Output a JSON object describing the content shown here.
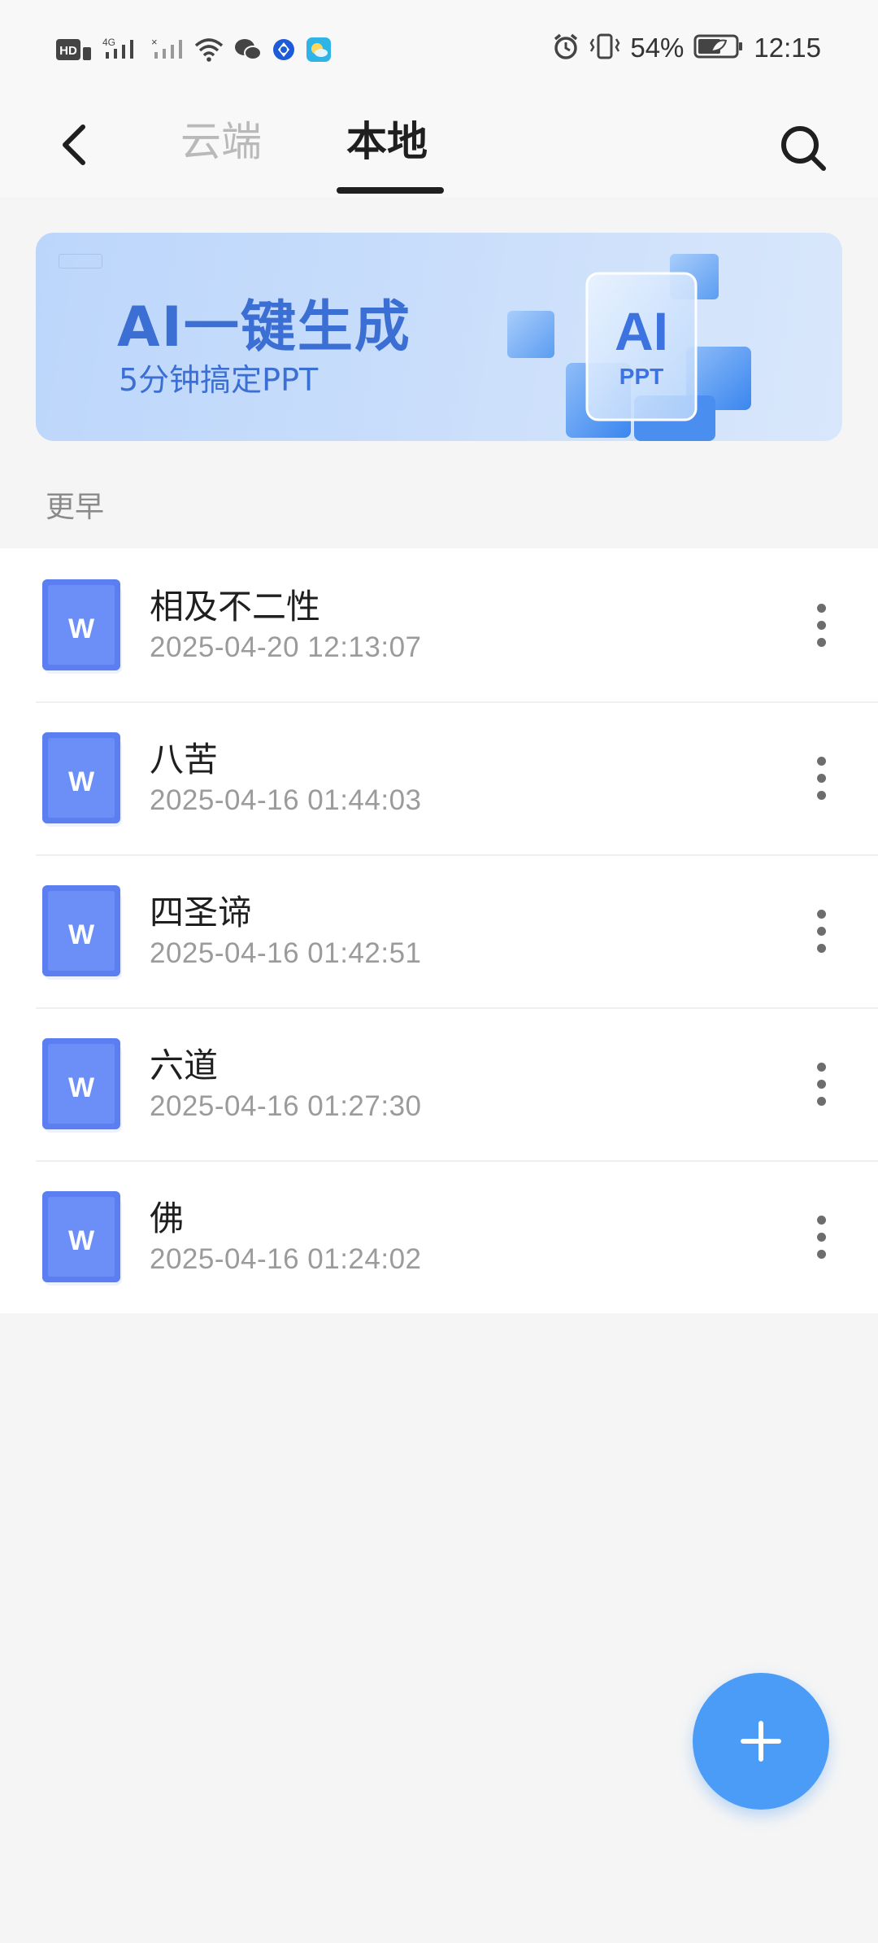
{
  "status_bar": {
    "battery_percent": "54%",
    "time": "12:15",
    "left_icons": [
      "hd-icon",
      "signal-4g-icon",
      "signal-no-sim-icon",
      "wifi-icon",
      "wechat-icon",
      "app-icon-blue",
      "app-icon-weather"
    ],
    "right_icons": [
      "alarm-icon",
      "vibrate-icon",
      "battery-icon"
    ]
  },
  "header": {
    "tabs": [
      {
        "label": "云端",
        "active": false
      },
      {
        "label": "本地",
        "active": true
      }
    ]
  },
  "banner": {
    "title": "AI一键生成",
    "subtitle": "5分钟搞定PPT",
    "art_label_main": "AI",
    "art_label_sub": "PPT"
  },
  "section": {
    "label": "更早"
  },
  "files": [
    {
      "name": "相及不二性",
      "date": "2025-04-20 12:13:07",
      "icon_letter": "W"
    },
    {
      "name": "八苦",
      "date": "2025-04-16 01:44:03",
      "icon_letter": "W"
    },
    {
      "name": "四圣谛",
      "date": "2025-04-16 01:42:51",
      "icon_letter": "W"
    },
    {
      "name": "六道",
      "date": "2025-04-16 01:27:30",
      "icon_letter": "W"
    },
    {
      "name": "佛",
      "date": "2025-04-16 01:24:02",
      "icon_letter": "W"
    }
  ],
  "colors": {
    "accent": "#4a9cf7",
    "doc_icon": "#5b7ff0",
    "banner_text": "#3c6fd3"
  }
}
